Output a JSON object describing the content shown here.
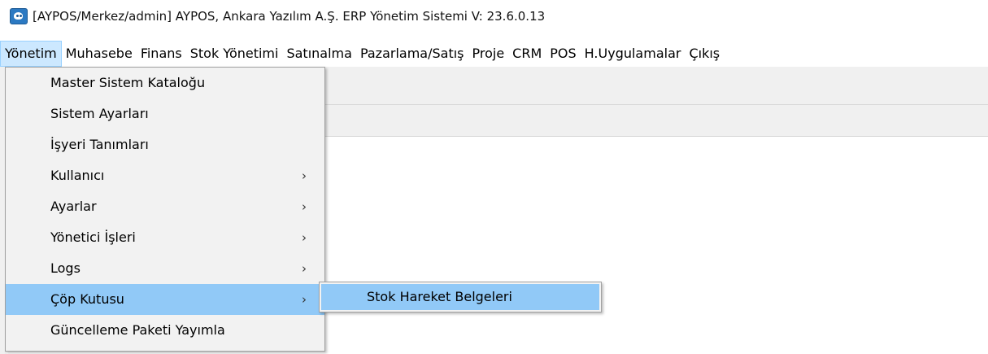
{
  "window": {
    "title": "[AYPOS/Merkez/admin] AYPOS, Ankara Yazılım A.Ş. ERP Yönetim Sistemi V: 23.6.0.13",
    "icon": "app-logo-icon"
  },
  "menubar": {
    "items": [
      {
        "label": "Yönetim"
      },
      {
        "label": "Muhasebe"
      },
      {
        "label": "Finans"
      },
      {
        "label": "Stok Yönetimi"
      },
      {
        "label": "Satınalma"
      },
      {
        "label": "Pazarlama/Satış"
      },
      {
        "label": "Proje"
      },
      {
        "label": "CRM"
      },
      {
        "label": "POS"
      },
      {
        "label": "H.Uygulamalar"
      },
      {
        "label": "Çıkış"
      }
    ]
  },
  "dropdown": {
    "items": [
      {
        "label": "Master Sistem Kataloğu",
        "submenu": false
      },
      {
        "label": "Sistem Ayarları",
        "submenu": false
      },
      {
        "label": "İşyeri Tanımları",
        "submenu": false
      },
      {
        "label": "Kullanıcı",
        "submenu": true
      },
      {
        "label": "Ayarlar",
        "submenu": true
      },
      {
        "label": "Yönetici İşleri",
        "submenu": true
      },
      {
        "label": "Logs",
        "submenu": true
      },
      {
        "label": "Çöp Kutusu",
        "submenu": true
      },
      {
        "label": "Güncelleme Paketi Yayımla",
        "submenu": false
      }
    ],
    "submenu_glyph": "›"
  },
  "submenu": {
    "items": [
      {
        "label": "Stok Hareket Belgeleri"
      }
    ]
  },
  "colors": {
    "highlight": "#91c9f7",
    "active_menu": "#cce8ff",
    "menu_bg": "#f2f2f2"
  }
}
